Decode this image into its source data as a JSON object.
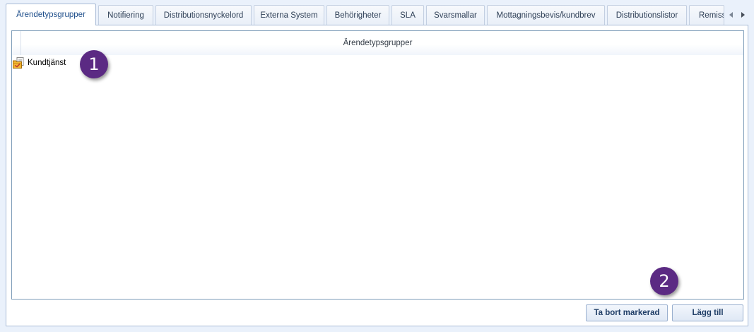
{
  "tabs": [
    {
      "label": "Ärendetypsgrupper",
      "active": true
    },
    {
      "label": "Notifiering"
    },
    {
      "label": "Distributionsnyckelord"
    },
    {
      "label": "Externa System"
    },
    {
      "label": "Behörigheter"
    },
    {
      "label": "SLA"
    },
    {
      "label": "Svarsmallar"
    },
    {
      "label": "Mottagningsbevis/kundbrev"
    },
    {
      "label": "Distributionslistor"
    },
    {
      "label": "Remiss"
    }
  ],
  "grid": {
    "column_header": "Ärendetypsgrupper",
    "rows": [
      {
        "label": "Kundtjänst",
        "icon": "folder-document-icon"
      }
    ]
  },
  "callouts": {
    "badge_1": "1",
    "badge_2": "2"
  },
  "buttons": {
    "remove_label": "Ta bort markerad",
    "add_label": "Lägg till"
  },
  "colors": {
    "accent": "#1f4f8b",
    "badge": "#5b2a83",
    "background": "#eaf1fb"
  }
}
